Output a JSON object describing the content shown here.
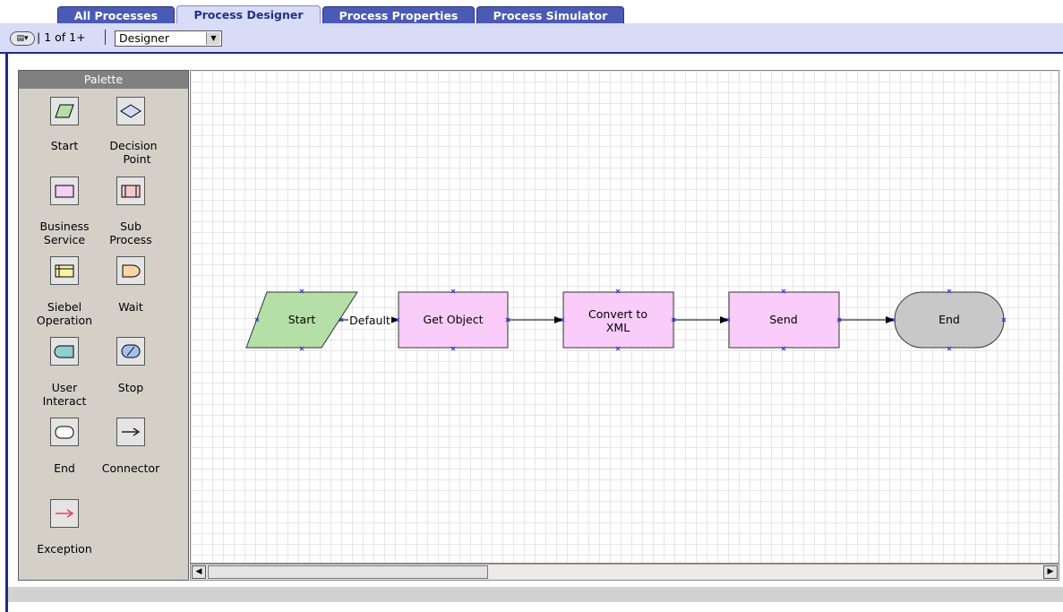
{
  "tabs": [
    {
      "label": "All Processes",
      "active": false
    },
    {
      "label": "Process Designer",
      "active": true
    },
    {
      "label": "Process Properties",
      "active": false
    },
    {
      "label": "Process Simulator",
      "active": false
    }
  ],
  "toolbar": {
    "record_count": "1 of 1+",
    "view_select": "Designer"
  },
  "palette": {
    "title": "Palette",
    "items": [
      {
        "label": "Start",
        "icon": "parallelogram-icon"
      },
      {
        "label": "Decision Point",
        "icon": "diamond-icon"
      },
      {
        "label": "Business Service",
        "icon": "rectangle-icon"
      },
      {
        "label": "Sub Process",
        "icon": "subprocess-icon"
      },
      {
        "label": "Siebel Operation",
        "icon": "operation-icon"
      },
      {
        "label": "Wait",
        "icon": "wait-icon"
      },
      {
        "label": "User Interact",
        "icon": "user-interact-icon"
      },
      {
        "label": "Stop",
        "icon": "stop-icon"
      },
      {
        "label": "End",
        "icon": "rounded-rect-icon"
      },
      {
        "label": "Connector",
        "icon": "arrow-icon"
      },
      {
        "label": "Exception",
        "icon": "red-arrow-icon"
      }
    ]
  },
  "diagram": {
    "steps": [
      {
        "id": "start",
        "label": "Start",
        "type": "start"
      },
      {
        "id": "get-object",
        "label": "Get Object",
        "type": "business-service"
      },
      {
        "id": "convert-xml",
        "label": "Convert to XML",
        "type": "business-service"
      },
      {
        "id": "send",
        "label": "Send",
        "type": "business-service"
      },
      {
        "id": "end",
        "label": "End",
        "type": "end"
      }
    ],
    "connectors": [
      {
        "from": "start",
        "to": "get-object",
        "label": "Default"
      },
      {
        "from": "get-object",
        "to": "convert-xml",
        "label": ""
      },
      {
        "from": "convert-xml",
        "to": "send",
        "label": ""
      },
      {
        "from": "send",
        "to": "end",
        "label": ""
      }
    ]
  },
  "colors": {
    "tab": "#4a5ab5",
    "tab_active": "#d8dcf6",
    "start_fill": "#b4dfa6",
    "service_fill": "#f9ccf9",
    "end_fill": "#c8c8c8",
    "handle": "#2b34c6"
  }
}
